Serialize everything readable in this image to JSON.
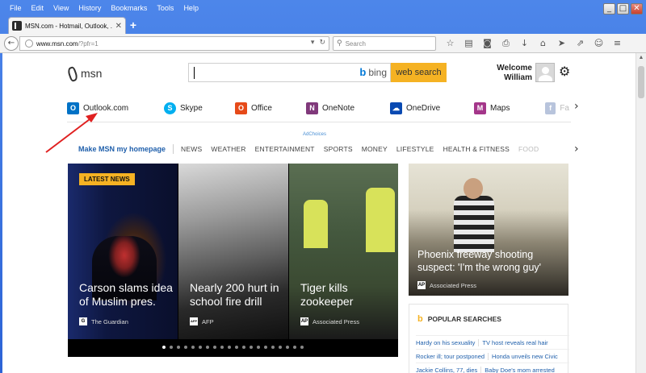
{
  "browser": {
    "menu": [
      "File",
      "Edit",
      "View",
      "History",
      "Bookmarks",
      "Tools",
      "Help"
    ],
    "tab_title": "MSN.com - Hotmail, Outlook, ...",
    "url_host": "www.msn.com",
    "url_rest": "/?pfr=1",
    "search_placeholder": "Search",
    "window_buttons": [
      "_",
      "□",
      "✕"
    ]
  },
  "header": {
    "logo_text": "msn",
    "bing_label": "bing",
    "search_button": "web search",
    "welcome_line1": "Welcome",
    "welcome_line2": "William"
  },
  "apps": [
    {
      "label": "Outlook.com",
      "icon": "outlook-icon",
      "color": "#0072c6",
      "glyph": "O"
    },
    {
      "label": "Skype",
      "icon": "skype-icon",
      "color": "#00aff0",
      "glyph": "S"
    },
    {
      "label": "Office",
      "icon": "office-icon",
      "color": "#e64a19",
      "glyph": "O"
    },
    {
      "label": "OneNote",
      "icon": "onenote-icon",
      "color": "#80397b",
      "glyph": "N"
    },
    {
      "label": "OneDrive",
      "icon": "onedrive-icon",
      "color": "#094ab2",
      "glyph": "☁"
    },
    {
      "label": "Maps",
      "icon": "maps-icon",
      "color": "#a4368a",
      "glyph": "M"
    },
    {
      "label": "Fa",
      "icon": "facebook-icon",
      "color": "#b8c4dc",
      "glyph": "f"
    }
  ],
  "adchoices": "AdChoices",
  "nav": {
    "homepage": "Make MSN my homepage",
    "links": [
      "NEWS",
      "WEATHER",
      "ENTERTAINMENT",
      "SPORTS",
      "MONEY",
      "LIFESTYLE",
      "HEALTH & FITNESS"
    ],
    "faded": "FOOD"
  },
  "hero": {
    "badge": "LATEST NEWS",
    "slides": [
      {
        "caption1": "Carson slams idea",
        "caption2": "of Muslim pres.",
        "source": "The Guardian",
        "src_glyph": "G"
      },
      {
        "caption1": "Nearly 200 hurt in",
        "caption2": "school fire drill",
        "source": "AFP",
        "src_glyph": "AFP"
      },
      {
        "caption1": "Tiger kills",
        "caption2": "zookeeper",
        "source": "Associated Press",
        "src_glyph": "AP"
      }
    ],
    "dot_count": 20
  },
  "feature": {
    "caption1": "Phoenix freeway shooting",
    "caption2": "suspect: 'I'm the wrong guy'",
    "source": "Associated Press",
    "src_glyph": "AP"
  },
  "popular": {
    "title": "POPULAR SEARCHES",
    "rows": [
      [
        "Hardy on his sexuality",
        "TV host reveals real hair"
      ],
      [
        "Rocker ill; tour postponed",
        "Honda unveils new Civic"
      ],
      [
        "Jackie Collins, 77, dies",
        "Baby Doe's mom arrested"
      ]
    ]
  },
  "colors": {
    "search_button": "#f5b223",
    "link_blue": "#1f5fab",
    "annotation_arrow": "#e02020"
  }
}
